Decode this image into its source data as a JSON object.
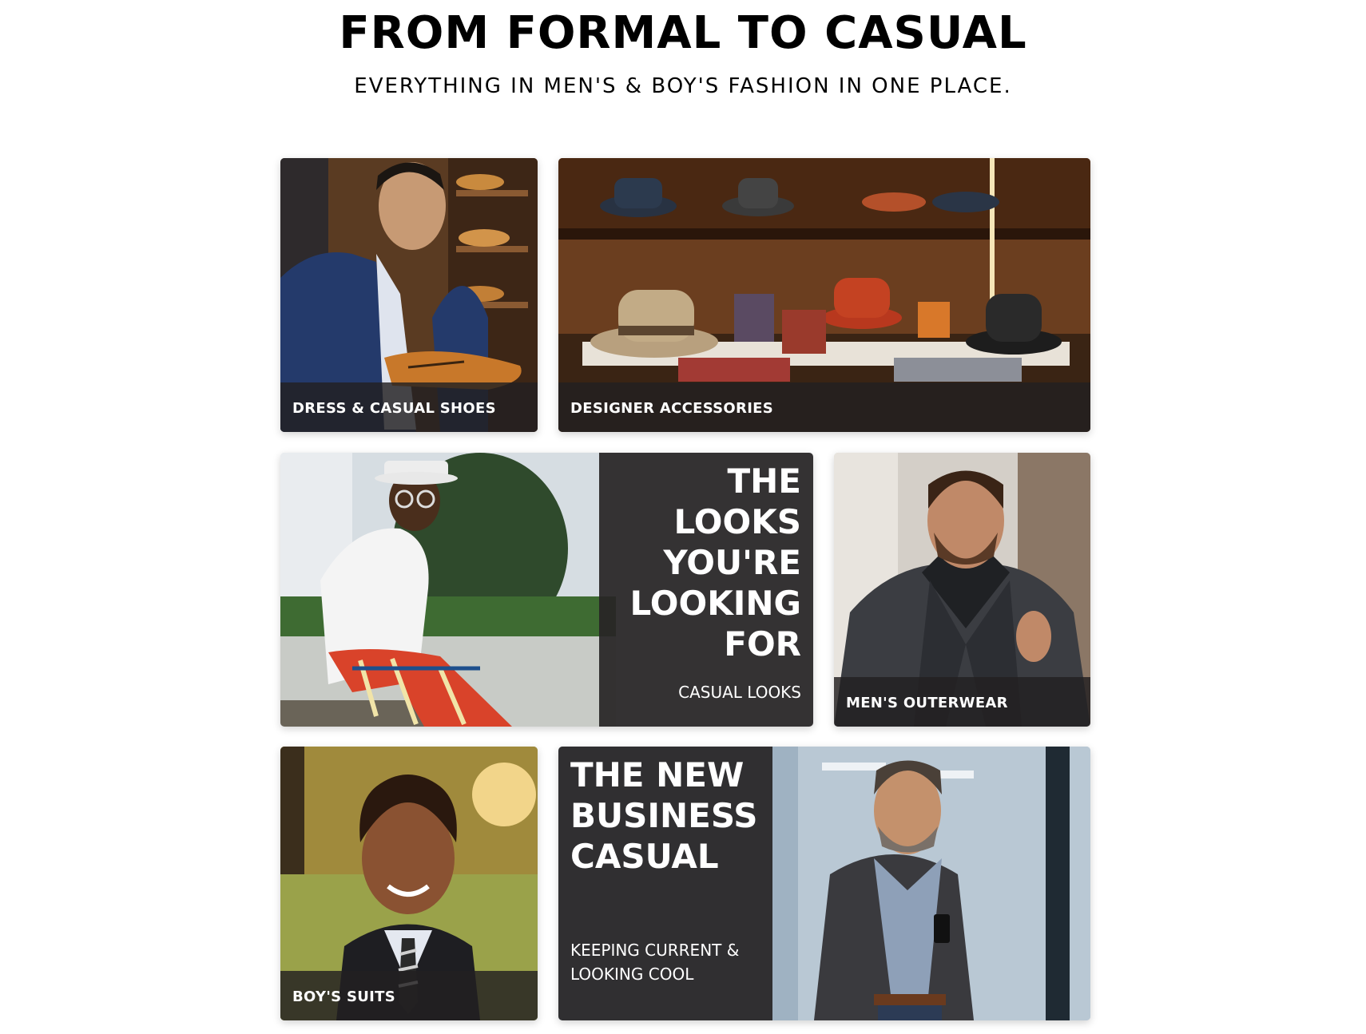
{
  "header": {
    "title": "FROM FORMAL TO CASUAL",
    "subtitle": "EVERYTHING IN MEN'S & BOY'S FASHION IN ONE PLACE."
  },
  "tiles": {
    "shoes": {
      "caption": "DRESS & CASUAL SHOES"
    },
    "accessories": {
      "caption": "DESIGNER ACCESSORIES"
    },
    "casual_looks": {
      "headline": "THE LOOKS YOU'RE LOOKING FOR",
      "subtext": "CASUAL LOOKS"
    },
    "outerwear": {
      "caption": "MEN'S OUTERWEAR"
    },
    "boys_suits": {
      "caption": "BOY'S SUITS"
    },
    "business_casual": {
      "headline": "THE NEW BUSINESS CASUAL",
      "subtext": "KEEPING CURRENT & LOOKING COOL"
    }
  },
  "colors": {
    "overlay": "#222021",
    "panel": "#282526",
    "text_on_dark": "#ffffff",
    "page_background": "#ffffff"
  }
}
